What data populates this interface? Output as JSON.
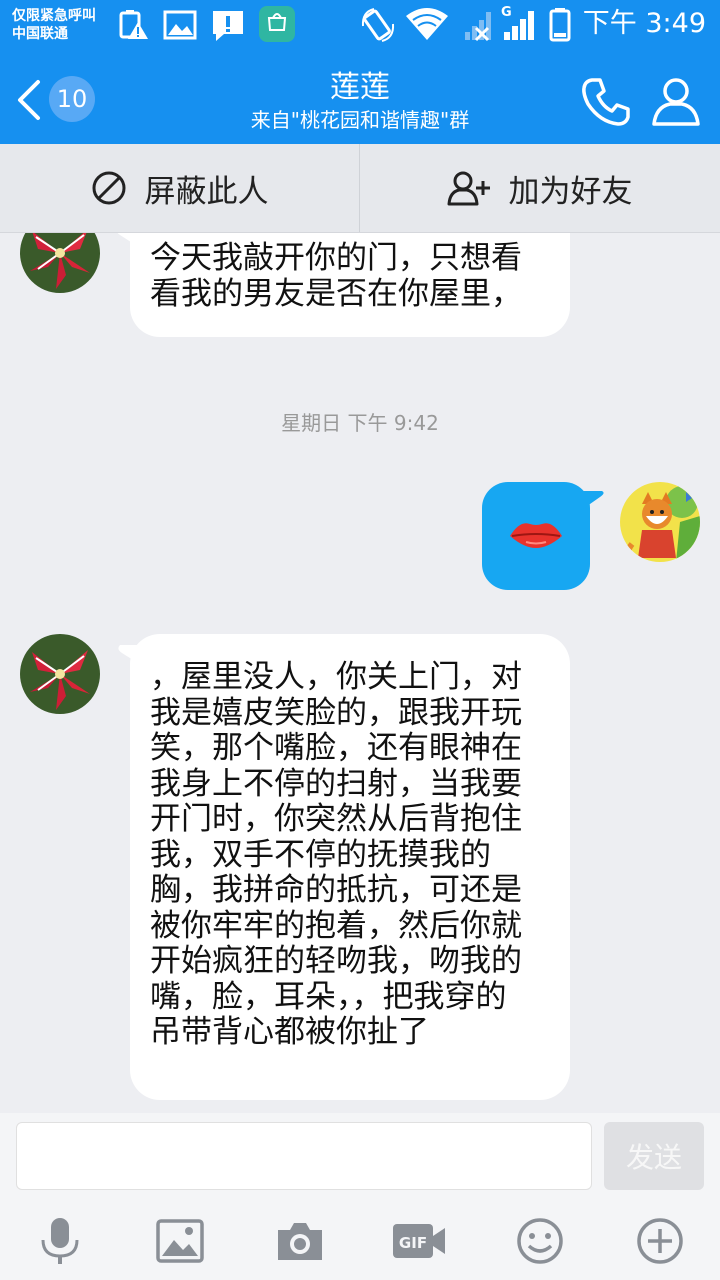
{
  "status_bar": {
    "carrier_line1": "仅限紧急呼叫",
    "carrier_line2": "中国联通",
    "network_type": "G",
    "time": "下午 3:49"
  },
  "header": {
    "unread_count": "10",
    "name": "莲莲",
    "subtitle": "来自\"桃花园和谐情趣\"群"
  },
  "actions": {
    "block_label": "屏蔽此人",
    "add_friend_label": "加为好友"
  },
  "messages": {
    "first_received_lines": [
      "今天我敲开你的门，只想看",
      "看我的男友是否在你屋里，"
    ],
    "timestamp": "星期日 下午 9:42",
    "sent_sticker": "lips-icon",
    "second_received_lines": [
      "，屋里没人，你关上门，对",
      "我是嬉皮笑脸的，跟我开玩",
      "笑，那个嘴脸，还有眼神在",
      "我身上不停的扫射，当我要",
      "开门时，你突然从后背抱住",
      "我，双手不停的抚摸我的",
      "胸，我拼命的抵抗，可还是",
      "被你牢牢的抱着，然后你就",
      "开始疯狂的轻吻我，吻我的",
      "嘴，脸，耳朵，，把我穿的",
      "吊带背心都被你扯了"
    ]
  },
  "input": {
    "value": "",
    "placeholder": "",
    "send_label": "发送"
  },
  "toolbar": [
    "microphone-icon",
    "image-icon",
    "camera-icon",
    "gif-icon",
    "emoji-icon",
    "plus-icon"
  ],
  "colors": {
    "header_blue": "#1690f0",
    "sent_bubble": "#17a7f2",
    "background": "#edeef2"
  }
}
